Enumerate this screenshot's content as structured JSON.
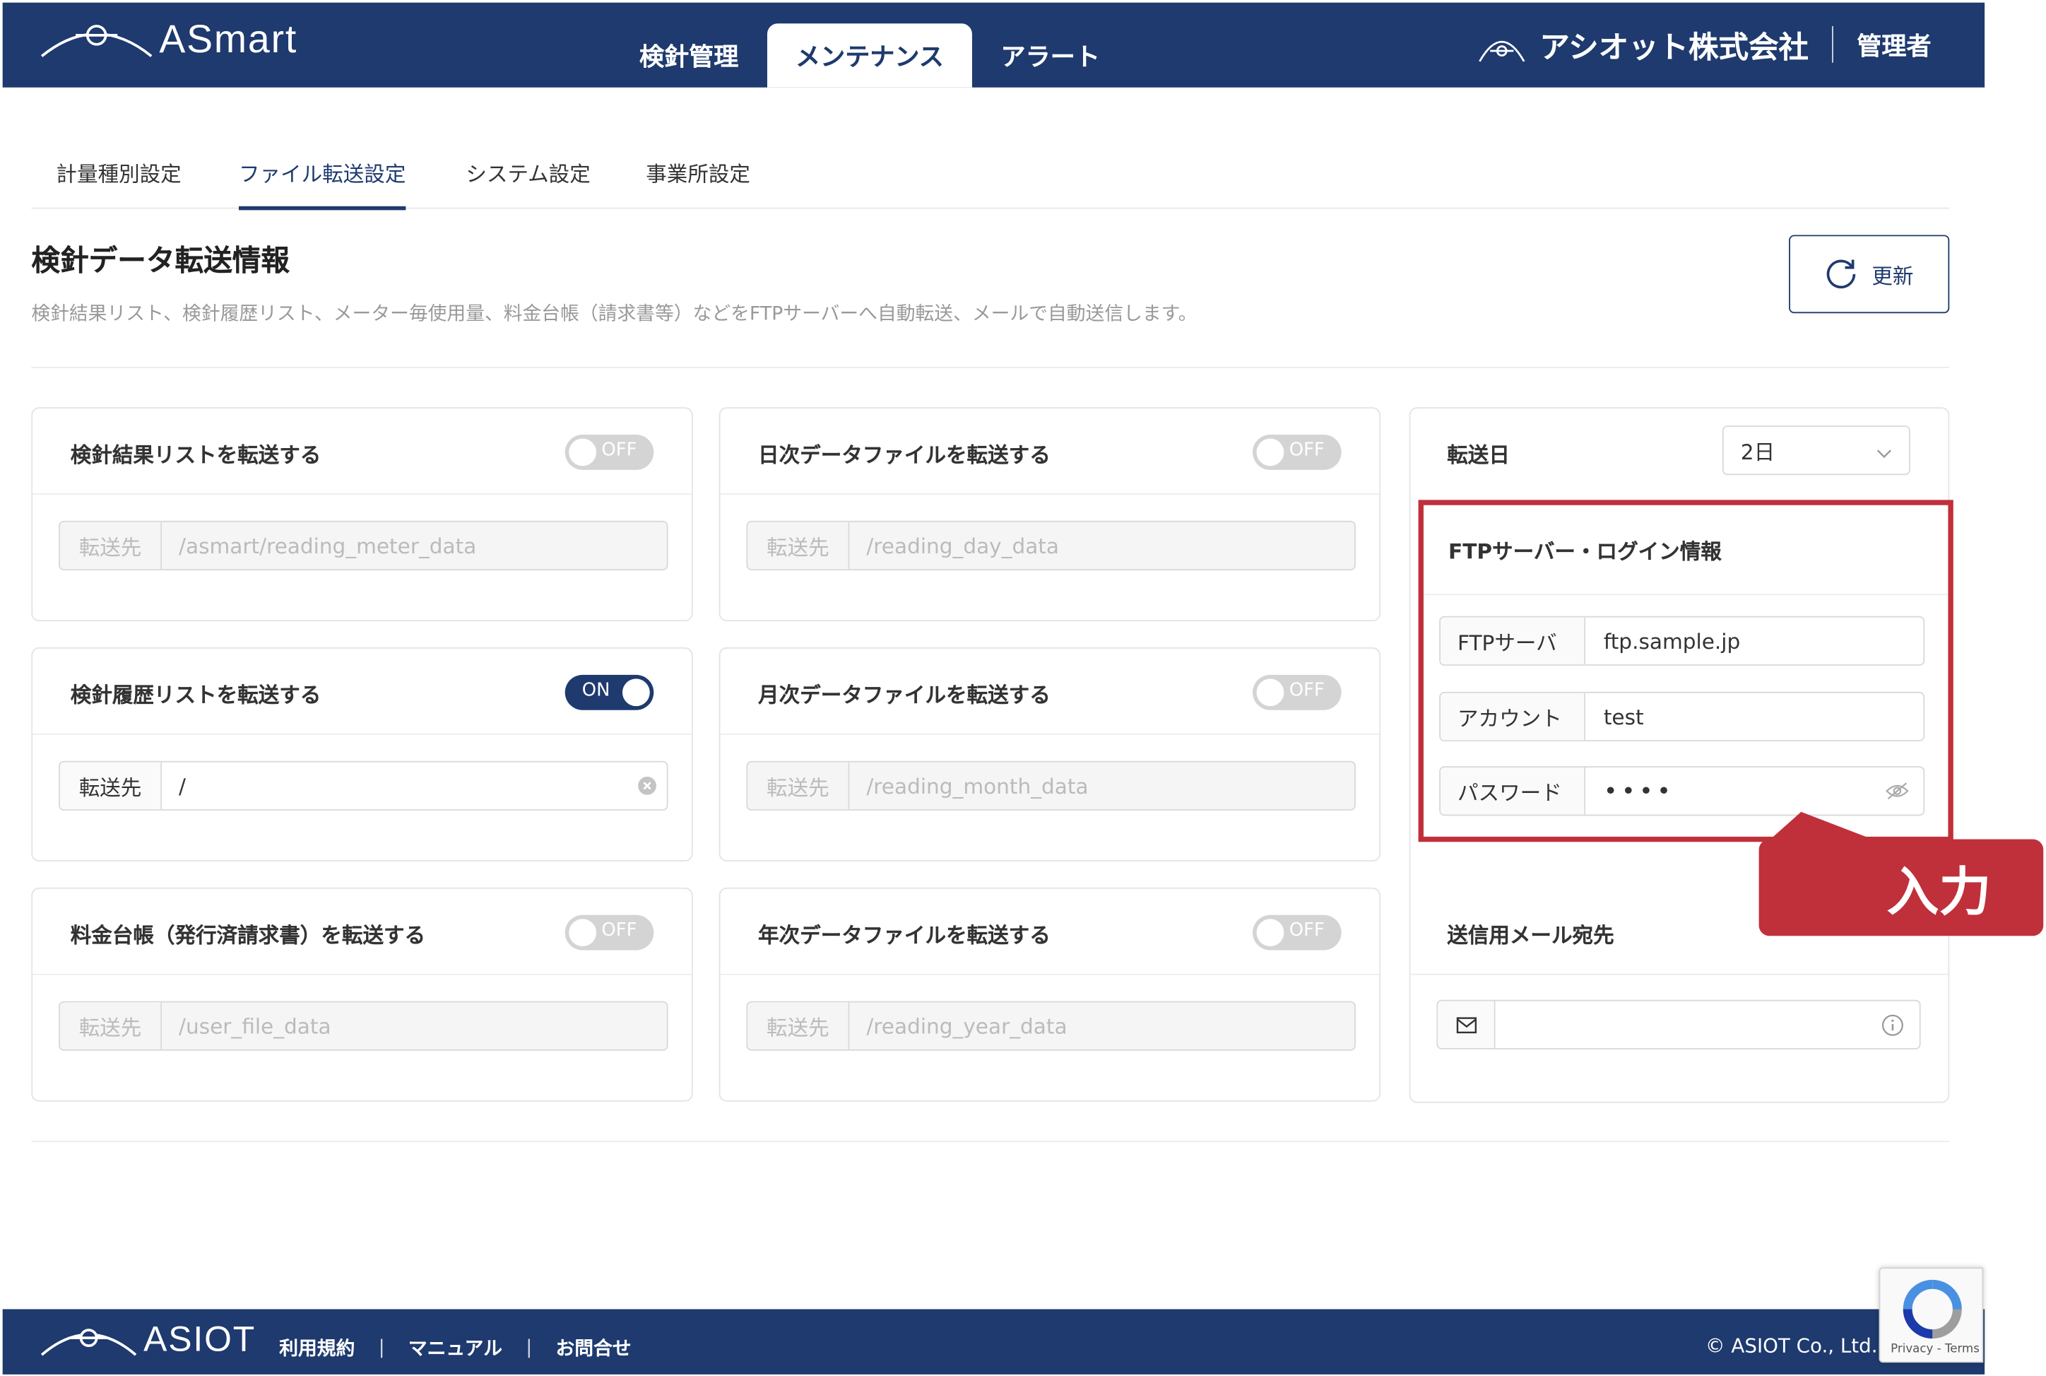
{
  "header": {
    "logo_text": "ASmart",
    "nav": [
      {
        "label": "検針管理"
      },
      {
        "label": "メンテナンス"
      },
      {
        "label": "アラート"
      }
    ],
    "company": "アシオット株式会社",
    "role": "管理者"
  },
  "subtabs": [
    {
      "label": "計量種別設定"
    },
    {
      "label": "ファイル転送設定"
    },
    {
      "label": "システム設定"
    },
    {
      "label": "事業所設定"
    }
  ],
  "page": {
    "title": "検針データ転送情報",
    "description": "検針結果リスト、検針履歴リスト、メーター毎使用量、料金台帳（請求書等）などをFTPサーバーへ自動転送、メールで自動送信します。",
    "refresh_label": "更新"
  },
  "cards": [
    {
      "title": "検針結果リストを転送する",
      "toggle": "OFF",
      "addon": "転送先",
      "value": "/asmart/reading_meter_data"
    },
    {
      "title": "日次データファイルを転送する",
      "toggle": "OFF",
      "addon": "転送先",
      "value": "/reading_day_data"
    },
    {
      "title": "検針履歴リストを転送する",
      "toggle": "ON",
      "addon": "転送先",
      "value": "/"
    },
    {
      "title": "月次データファイルを転送する",
      "toggle": "OFF",
      "addon": "転送先",
      "value": "/reading_month_data"
    },
    {
      "title": "料金台帳（発行済請求書）を転送する",
      "toggle": "OFF",
      "addon": "転送先",
      "value": "/user_file_data"
    },
    {
      "title": "年次データファイルを転送する",
      "toggle": "OFF",
      "addon": "転送先",
      "value": "/reading_year_data"
    }
  ],
  "transfer_day": {
    "label": "転送日",
    "value": "2日"
  },
  "ftp": {
    "title": "FTPサーバー・ログイン情報",
    "fields": [
      {
        "label": "FTPサーバ",
        "value": "ftp.sample.jp"
      },
      {
        "label": "アカウント",
        "value": "test"
      },
      {
        "label": "パスワード",
        "value": "••••"
      }
    ]
  },
  "callout": "入力",
  "mail": {
    "label": "送信用メール宛先",
    "value": ""
  },
  "footer": {
    "logo_text": "ASIOT",
    "links": [
      {
        "label": "利用規約"
      },
      {
        "label": "マニュアル"
      },
      {
        "label": "お問合せ"
      }
    ],
    "copyright": "© ASIOT Co., Ltd."
  },
  "recaptcha": {
    "text": "Privacy - Terms"
  },
  "colors": {
    "brand": "#1e3a6e",
    "highlight": "#c0303a"
  }
}
